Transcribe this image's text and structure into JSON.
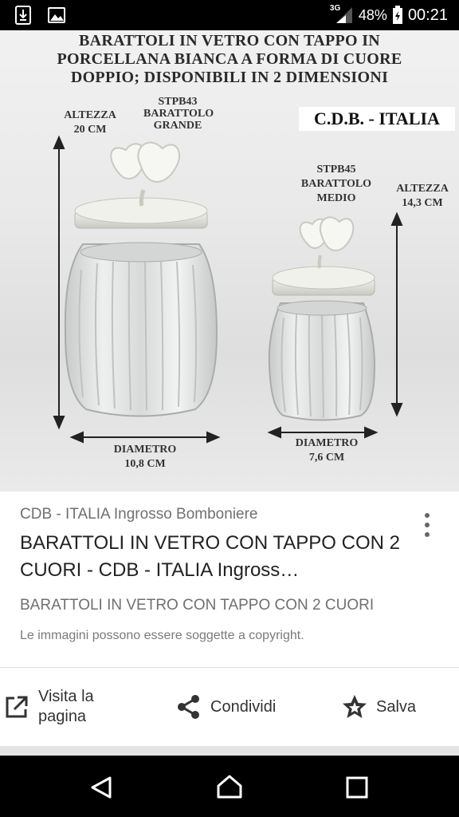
{
  "status_bar": {
    "network": "3G",
    "battery": "48%",
    "time": "00:21"
  },
  "image": {
    "title_lines": [
      "BARATTOLI IN VETRO CON TAPPO IN",
      "PORCELLANA BIANCA A FORMA DI CUORE",
      "DOPPIO; DISPONIBILI IN 2 DIMENSIONI"
    ],
    "brand": "C.D.B. - ITALIA",
    "big_jar": {
      "code_lines": [
        "STPB43",
        "BARATTOLO",
        "GRANDE"
      ],
      "height_lines": [
        "ALTEZZA",
        "20 CM"
      ],
      "diameter_lines": [
        "DIAMETRO",
        "10,8 CM"
      ]
    },
    "small_jar": {
      "code_lines": [
        "STPB45",
        "BARATTOLO",
        "MEDIO"
      ],
      "height_lines": [
        "ALTEZZA",
        "14,3 CM"
      ],
      "diameter_lines": [
        "DIAMETRO",
        "7,6 CM"
      ]
    }
  },
  "card": {
    "source": "CDB - ITALIA Ingrosso Bomboniere",
    "title": "BARATTOLI IN VETRO CON TAPPO CON 2 CUORI - CDB - ITALIA Ingross…",
    "description": "BARATTOLI IN VETRO CON TAPPO CON 2 CUORI",
    "copyright_note": "Le immagini possono essere soggette a copyright."
  },
  "actions": {
    "visit_label": "Visita la pagina",
    "share_label": "Condividi",
    "save_label": "Salva"
  },
  "icons": {
    "more": "more-vert-icon",
    "visit": "open-in-new-icon",
    "share": "share-icon",
    "save": "star-icon",
    "back": "back-triangle-icon",
    "home": "home-icon",
    "recent": "recent-apps-icon"
  }
}
